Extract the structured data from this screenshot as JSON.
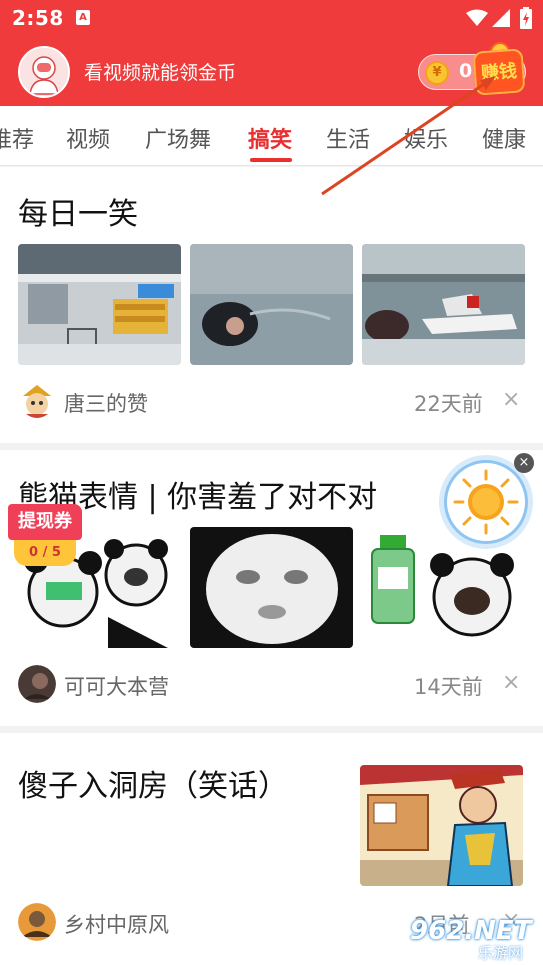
{
  "status_bar": {
    "time": "2:58",
    "app_badge": "A"
  },
  "header": {
    "text": "看视频就能领金币",
    "coin_symbol": "¥",
    "coin_count": "0",
    "earn_label": "赚钱"
  },
  "tabs": {
    "items": [
      "推荐",
      "视频",
      "广场舞",
      "搞笑",
      "生活",
      "娱乐",
      "健康"
    ],
    "active": "搞笑"
  },
  "feed": [
    {
      "title": "每日一笑",
      "author": "唐三的赞",
      "time": "22天前",
      "close": "×"
    },
    {
      "title": "熊猫表情 | 你害羞了对不对",
      "author": "可可大本营",
      "time": "14天前",
      "close": "×"
    },
    {
      "title": "傻子入洞房（笑话）",
      "author": "乡村中原风",
      "time": "2月前",
      "close": "×"
    }
  ],
  "overlays": {
    "voucher_label": "提现券",
    "voucher_progress": "0 / 5",
    "float_close": "×"
  },
  "watermark": {
    "text": "962.NET",
    "sub": "乐游网"
  },
  "colors": {
    "brand_red": "#ef3b3b",
    "active_tab": "#e83030",
    "coin_gold": "#f8c531"
  }
}
